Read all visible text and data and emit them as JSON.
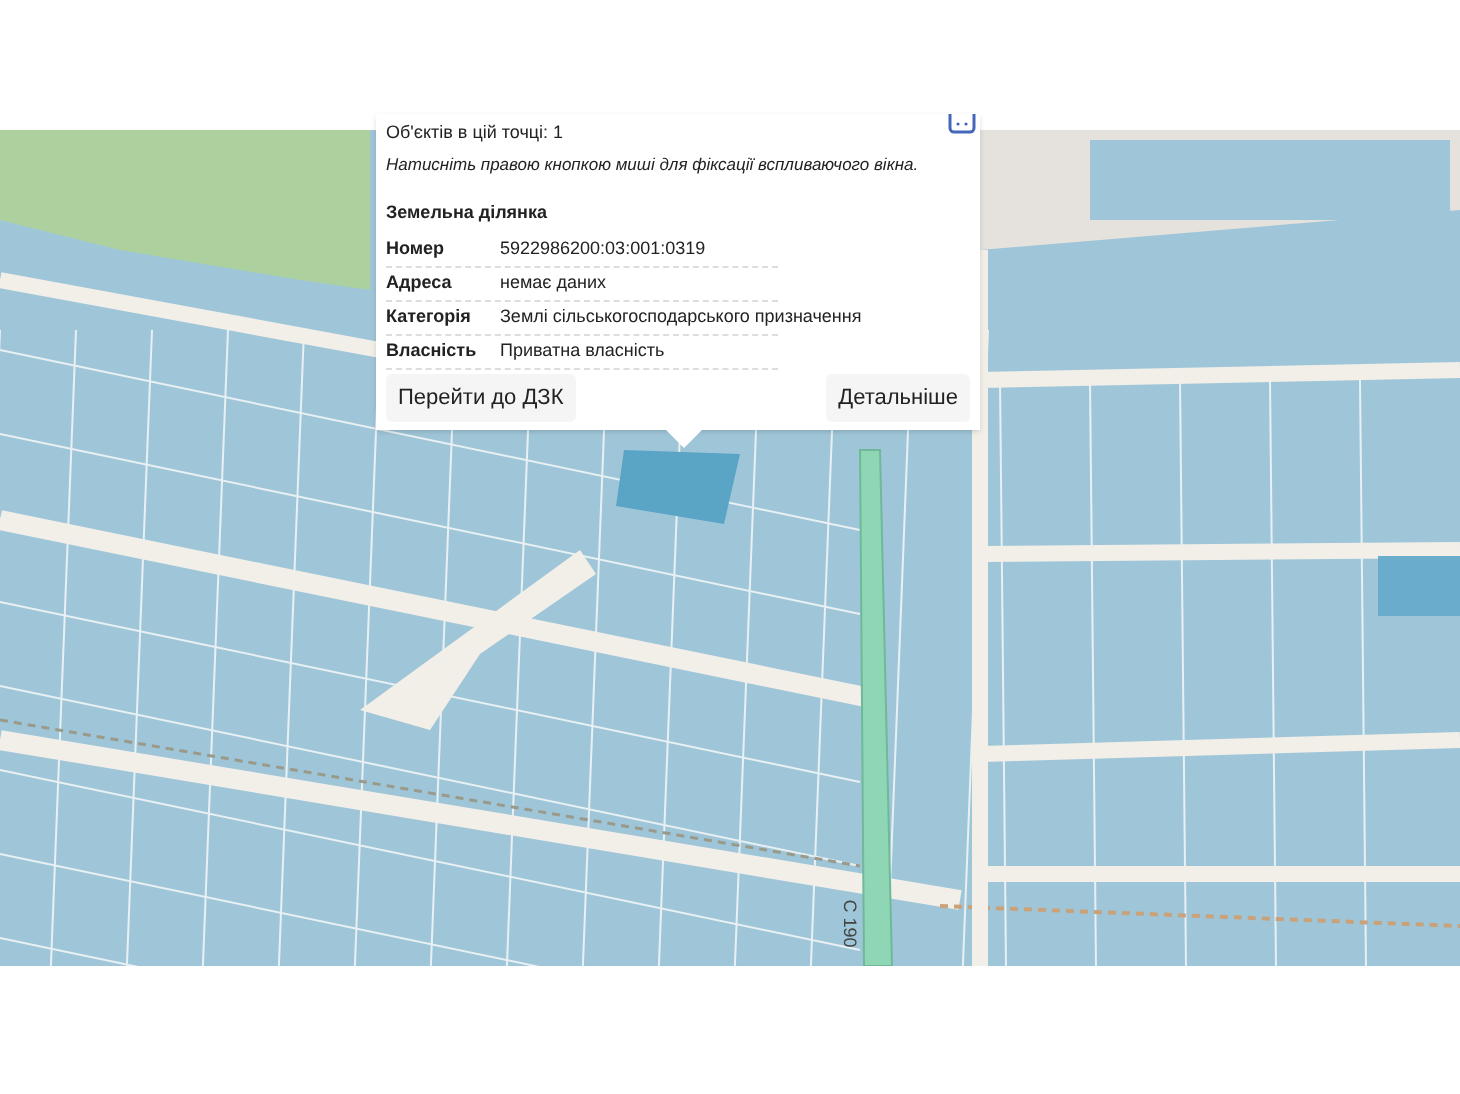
{
  "popup": {
    "objects_count": "Об'єктів в цій точці: 1",
    "hint": "Натисніть правою кнопкою миші для фіксації вспливаючого вікна.",
    "section_title": "Земельна ділянка",
    "fields": [
      {
        "label": "Номер",
        "value": "5922986200:03:001:0319"
      },
      {
        "label": "Адреса",
        "value": "немає даних"
      },
      {
        "label": "Категорія",
        "value": "Землі сільськогосподарського призначення"
      },
      {
        "label": "Власність",
        "value": "Приватна власність"
      }
    ],
    "buttons": [
      "Перейти до ДЗК",
      "Детальніше"
    ]
  },
  "map": {
    "road_label": "С 190"
  }
}
